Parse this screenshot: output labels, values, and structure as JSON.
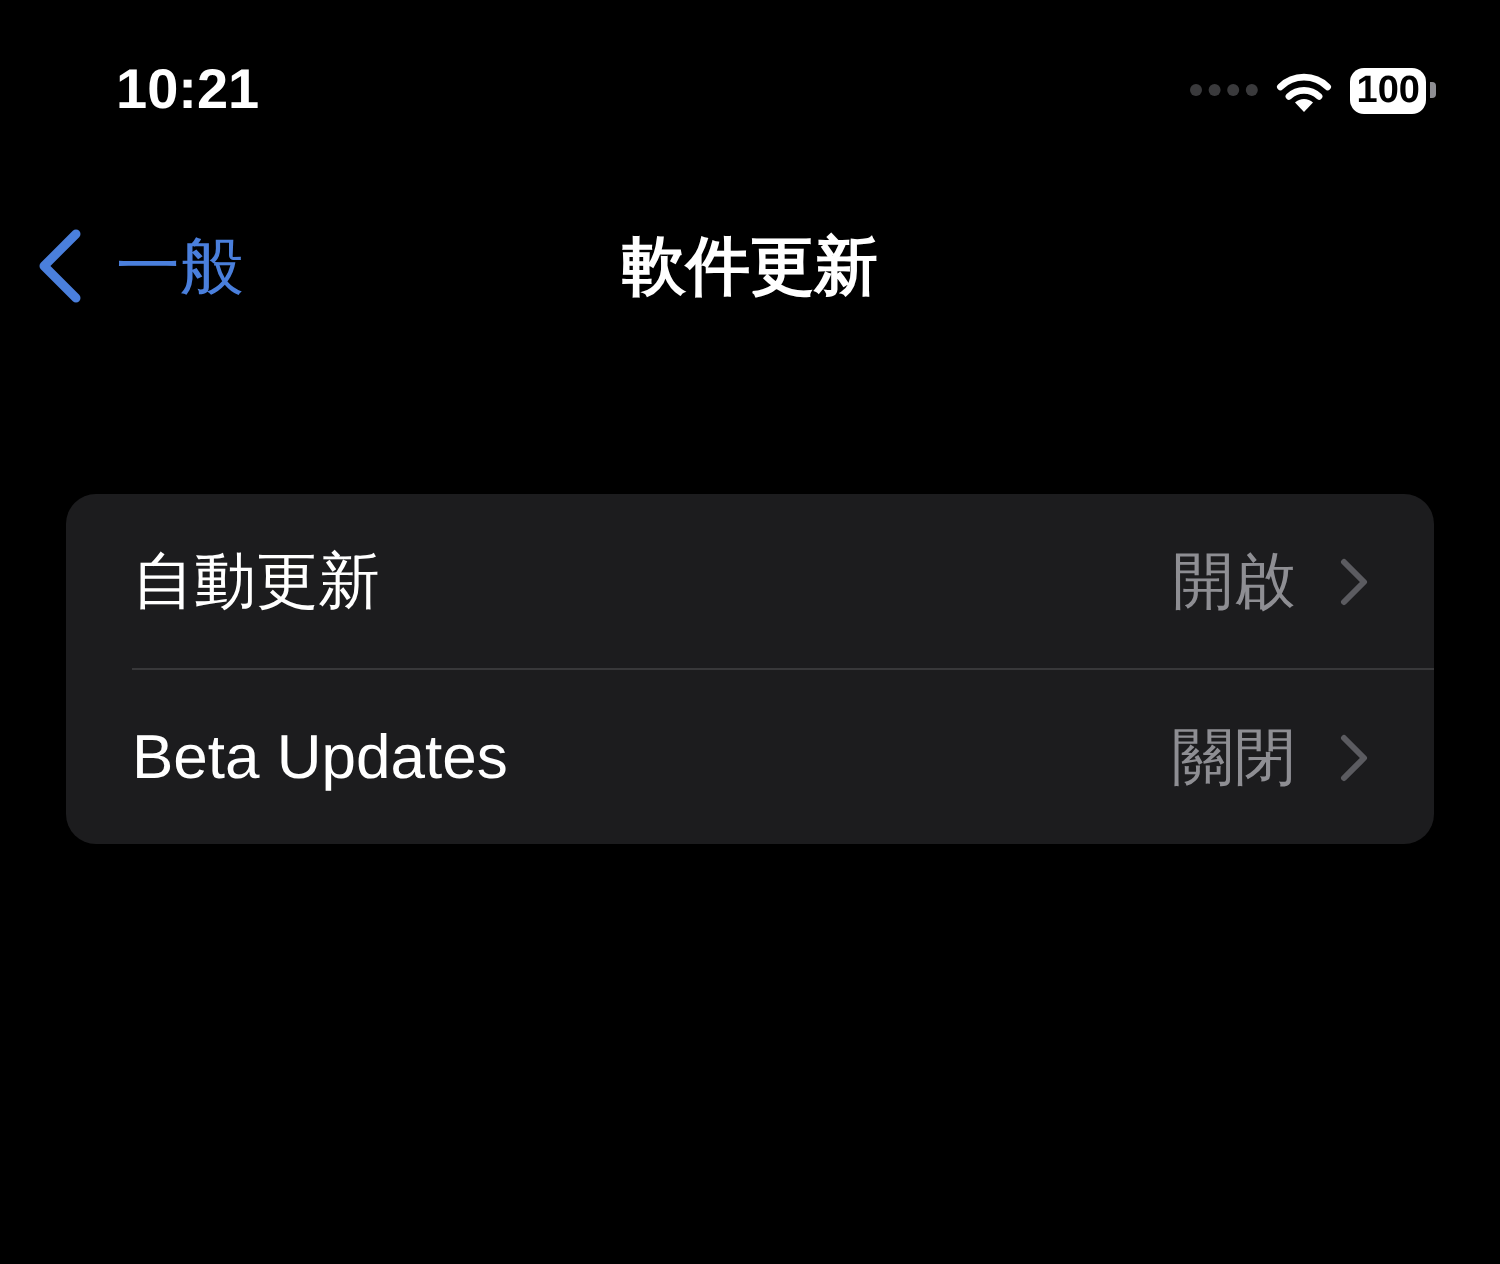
{
  "status_bar": {
    "time": "10:21",
    "battery": "100"
  },
  "nav": {
    "back_label": "一般",
    "title": "軟件更新"
  },
  "settings": [
    {
      "label": "自動更新",
      "value": "開啟"
    },
    {
      "label": "Beta Updates",
      "value": "關閉"
    }
  ]
}
